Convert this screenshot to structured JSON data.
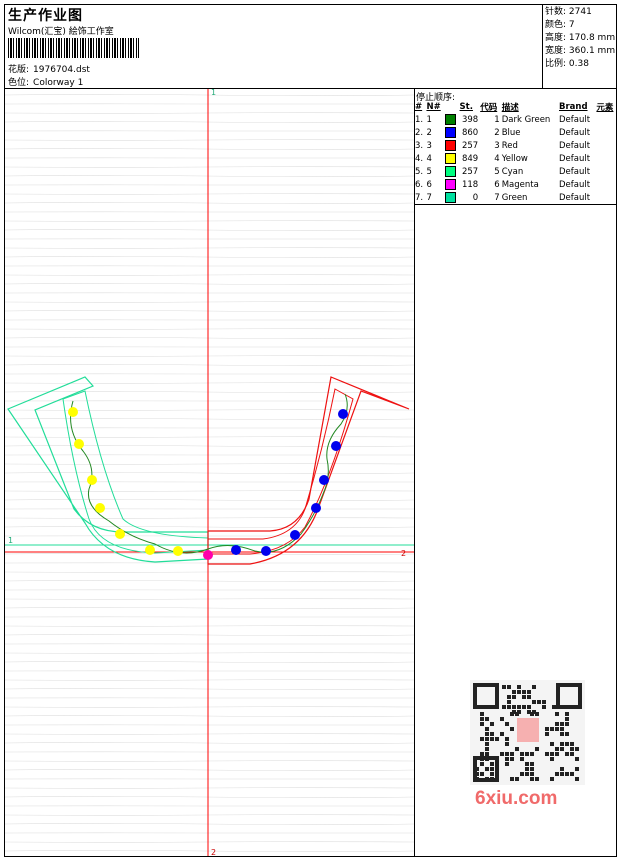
{
  "header": {
    "title": "生产作业图",
    "company": "Wilcom(汇宝) 絵饰工作室",
    "design_label": "花版:",
    "design_file": "1976704.dst",
    "colorway_label": "色位:",
    "colorway": "Colorway 1"
  },
  "stats": [
    {
      "label": "针数:",
      "value": "2741"
    },
    {
      "label": "颜色:",
      "value": "7"
    },
    {
      "label": "高度:",
      "value": "170.8 mm"
    },
    {
      "label": "宽度:",
      "value": "360.1 mm"
    },
    {
      "label": "比例:",
      "value": "0.38"
    }
  ],
  "stop_sequence": {
    "title": "停止顺序:",
    "headers": [
      "#",
      "N#",
      "St.",
      "代码",
      "描述",
      "Brand",
      "元素"
    ],
    "rows": [
      {
        "idx": "1.",
        "n": "1",
        "color": "#008000",
        "st": "398",
        "code": "1",
        "desc": "Dark Green",
        "brand": "Default"
      },
      {
        "idx": "2.",
        "n": "2",
        "color": "#0000ff",
        "st": "860",
        "code": "2",
        "desc": "Blue",
        "brand": "Default"
      },
      {
        "idx": "3.",
        "n": "3",
        "color": "#ff0000",
        "st": "257",
        "code": "3",
        "desc": "Red",
        "brand": "Default"
      },
      {
        "idx": "4.",
        "n": "4",
        "color": "#ffff00",
        "st": "849",
        "code": "4",
        "desc": "Yellow",
        "brand": "Default"
      },
      {
        "idx": "5.",
        "n": "5",
        "color": "#00ff80",
        "st": "257",
        "code": "5",
        "desc": "Cyan",
        "brand": "Default"
      },
      {
        "idx": "6.",
        "n": "6",
        "color": "#ff00ff",
        "st": "118",
        "code": "6",
        "desc": "Magenta",
        "brand": "Default"
      },
      {
        "idx": "7.",
        "n": "7",
        "color": "#00e0a0",
        "st": "0",
        "code": "7",
        "desc": "Green",
        "brand": "Default"
      }
    ]
  },
  "axis_labels": {
    "top": "1",
    "bottom": "2",
    "left": "1",
    "right": "2"
  },
  "colors": {
    "green_outline": "#22dd99",
    "red_outline": "#ee1111",
    "vine": "#228822",
    "yellow": "#ffff00",
    "blue": "#0000ee",
    "magenta": "#ff00aa"
  },
  "watermark": "6xiu.com"
}
